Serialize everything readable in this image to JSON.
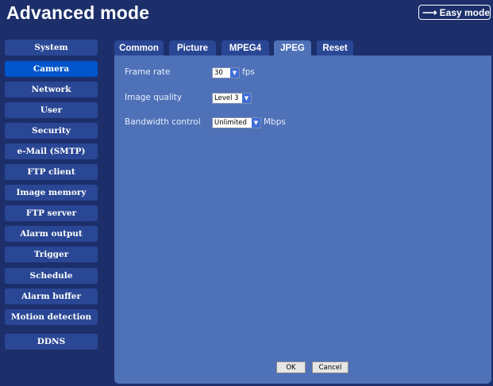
{
  "header": {
    "title": "Advanced mode",
    "easy_mode_arrow": "⟶",
    "easy_mode_label": "Easy mode"
  },
  "sidebar": {
    "items": [
      {
        "label": "System",
        "active": false
      },
      {
        "label": "Camera",
        "active": true
      },
      {
        "label": "Network",
        "active": false
      },
      {
        "label": "User",
        "active": false
      },
      {
        "label": "Security",
        "active": false
      },
      {
        "label": "e-Mail (SMTP)",
        "active": false
      },
      {
        "label": "FTP client",
        "active": false
      },
      {
        "label": "Image memory",
        "active": false
      },
      {
        "label": "FTP server",
        "active": false
      },
      {
        "label": "Alarm output",
        "active": false
      },
      {
        "label": "Trigger",
        "active": false
      },
      {
        "label": "Schedule",
        "active": false
      },
      {
        "label": "Alarm buffer",
        "active": false
      },
      {
        "label": "Motion detection",
        "active": false
      },
      {
        "label": "DDNS",
        "active": false
      }
    ]
  },
  "tabs": [
    {
      "label": "Common",
      "active": false
    },
    {
      "label": "Picture",
      "active": false
    },
    {
      "label": "MPEG4",
      "active": false
    },
    {
      "label": "JPEG",
      "active": true
    },
    {
      "label": "Reset",
      "active": false
    }
  ],
  "form": {
    "frame_rate": {
      "label": "Frame rate",
      "value": "30",
      "unit": "fps"
    },
    "image_quality": {
      "label": "Image quality",
      "value": "Level 3"
    },
    "bandwidth_control": {
      "label": "Bandwidth control",
      "value": "Unlimited",
      "unit": "Mbps"
    }
  },
  "buttons": {
    "ok": "OK",
    "cancel": "Cancel"
  },
  "colors": {
    "background": "#1c2f6b",
    "panel": "#4f71b8",
    "menu_item": "#2a4795",
    "menu_active": "#0055cc"
  }
}
